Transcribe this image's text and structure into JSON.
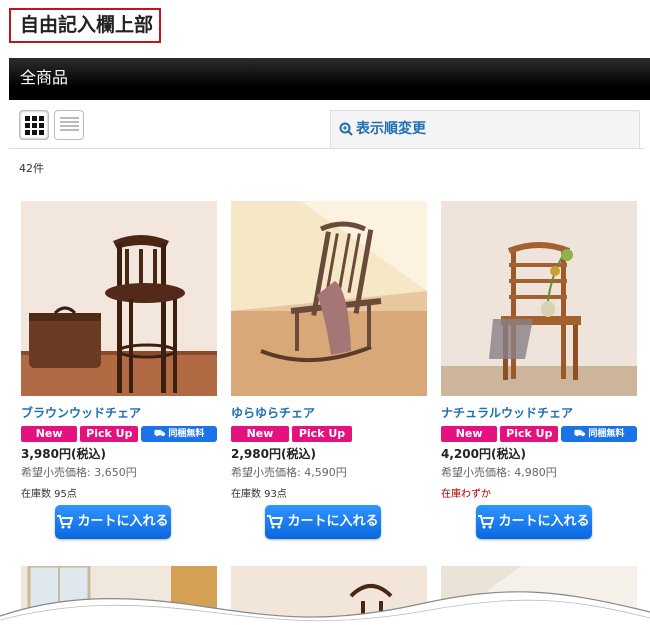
{
  "free_area_top": "自由記入欄上部",
  "category_title": "全商品",
  "sort_label": "表示順変更",
  "count": "42件",
  "cart_label": "カートに入れる",
  "msrp_prefix": "希望小売価格: ",
  "products": [
    {
      "name": "ブラウンウッドチェア",
      "price": "3,980円(税込)",
      "msrp": "希望小売価格: 3,650円",
      "stock": "在庫数 95点",
      "badges": {
        "new": "New",
        "pick": "Pick Up",
        "ship": "同梱無料"
      }
    },
    {
      "name": "ゆらゆらチェア",
      "price": "2,980円(税込)",
      "msrp": "希望小売価格: 4,590円",
      "stock": "在庫数 93点",
      "badges": {
        "new": "New",
        "pick": "Pick Up"
      }
    },
    {
      "name": "ナチュラルウッドチェア",
      "price": "4,200円(税込)",
      "msrp": "希望小売価格: 4,980円",
      "stock": "在庫わずか",
      "badges": {
        "new": "New",
        "pick": "Pick Up",
        "ship": "同梱無料"
      }
    }
  ],
  "colors": {
    "accent_red": "#c2141a",
    "badge_pink": "#e3127f",
    "link_blue": "#1c6fb3",
    "button_blue": "#1a73e8"
  }
}
